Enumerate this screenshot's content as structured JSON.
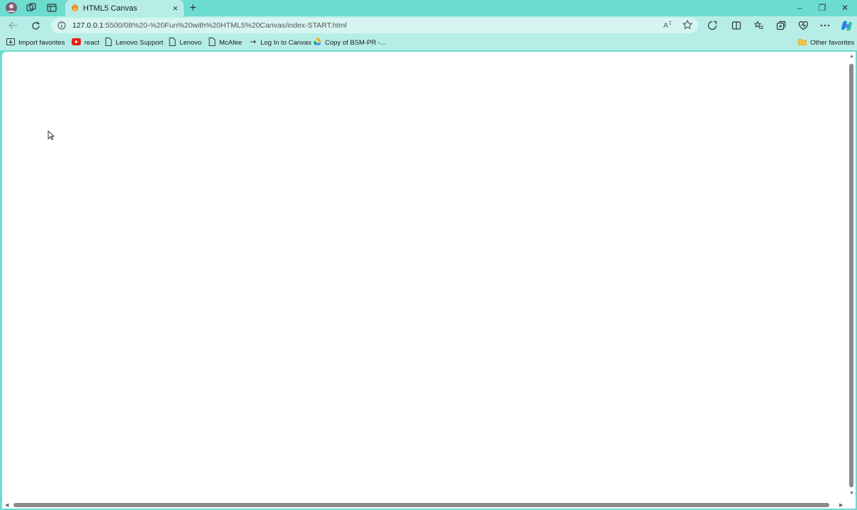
{
  "tab": {
    "title": "HTML5 Canvas",
    "close": "×"
  },
  "new_tab": "+",
  "window": {
    "minimize": "–",
    "restore": "❐",
    "close": "✕"
  },
  "address": {
    "host": "127.0.0.1",
    "path": ":5500/08%20-%20Fun%20with%20HTML5%20Canvas/index-START.html"
  },
  "bookmarks": {
    "items": [
      {
        "label": "Import favorites",
        "icon": "import-icon"
      },
      {
        "label": "react",
        "icon": "youtube-icon"
      },
      {
        "label": "Lenovo Support",
        "icon": "page-icon"
      },
      {
        "label": "Lenovo",
        "icon": "page-icon"
      },
      {
        "label": "McAfee",
        "icon": "page-icon"
      },
      {
        "label": "Log In to Canvas",
        "icon": "arrow-icon"
      },
      {
        "label": "Copy of BSM-PR -...",
        "icon": "drive-icon"
      }
    ],
    "other": "Other favorites"
  },
  "colors": {
    "frame": "#6cdccf",
    "toolbar": "#b6eee7",
    "page": "#ffffff"
  }
}
